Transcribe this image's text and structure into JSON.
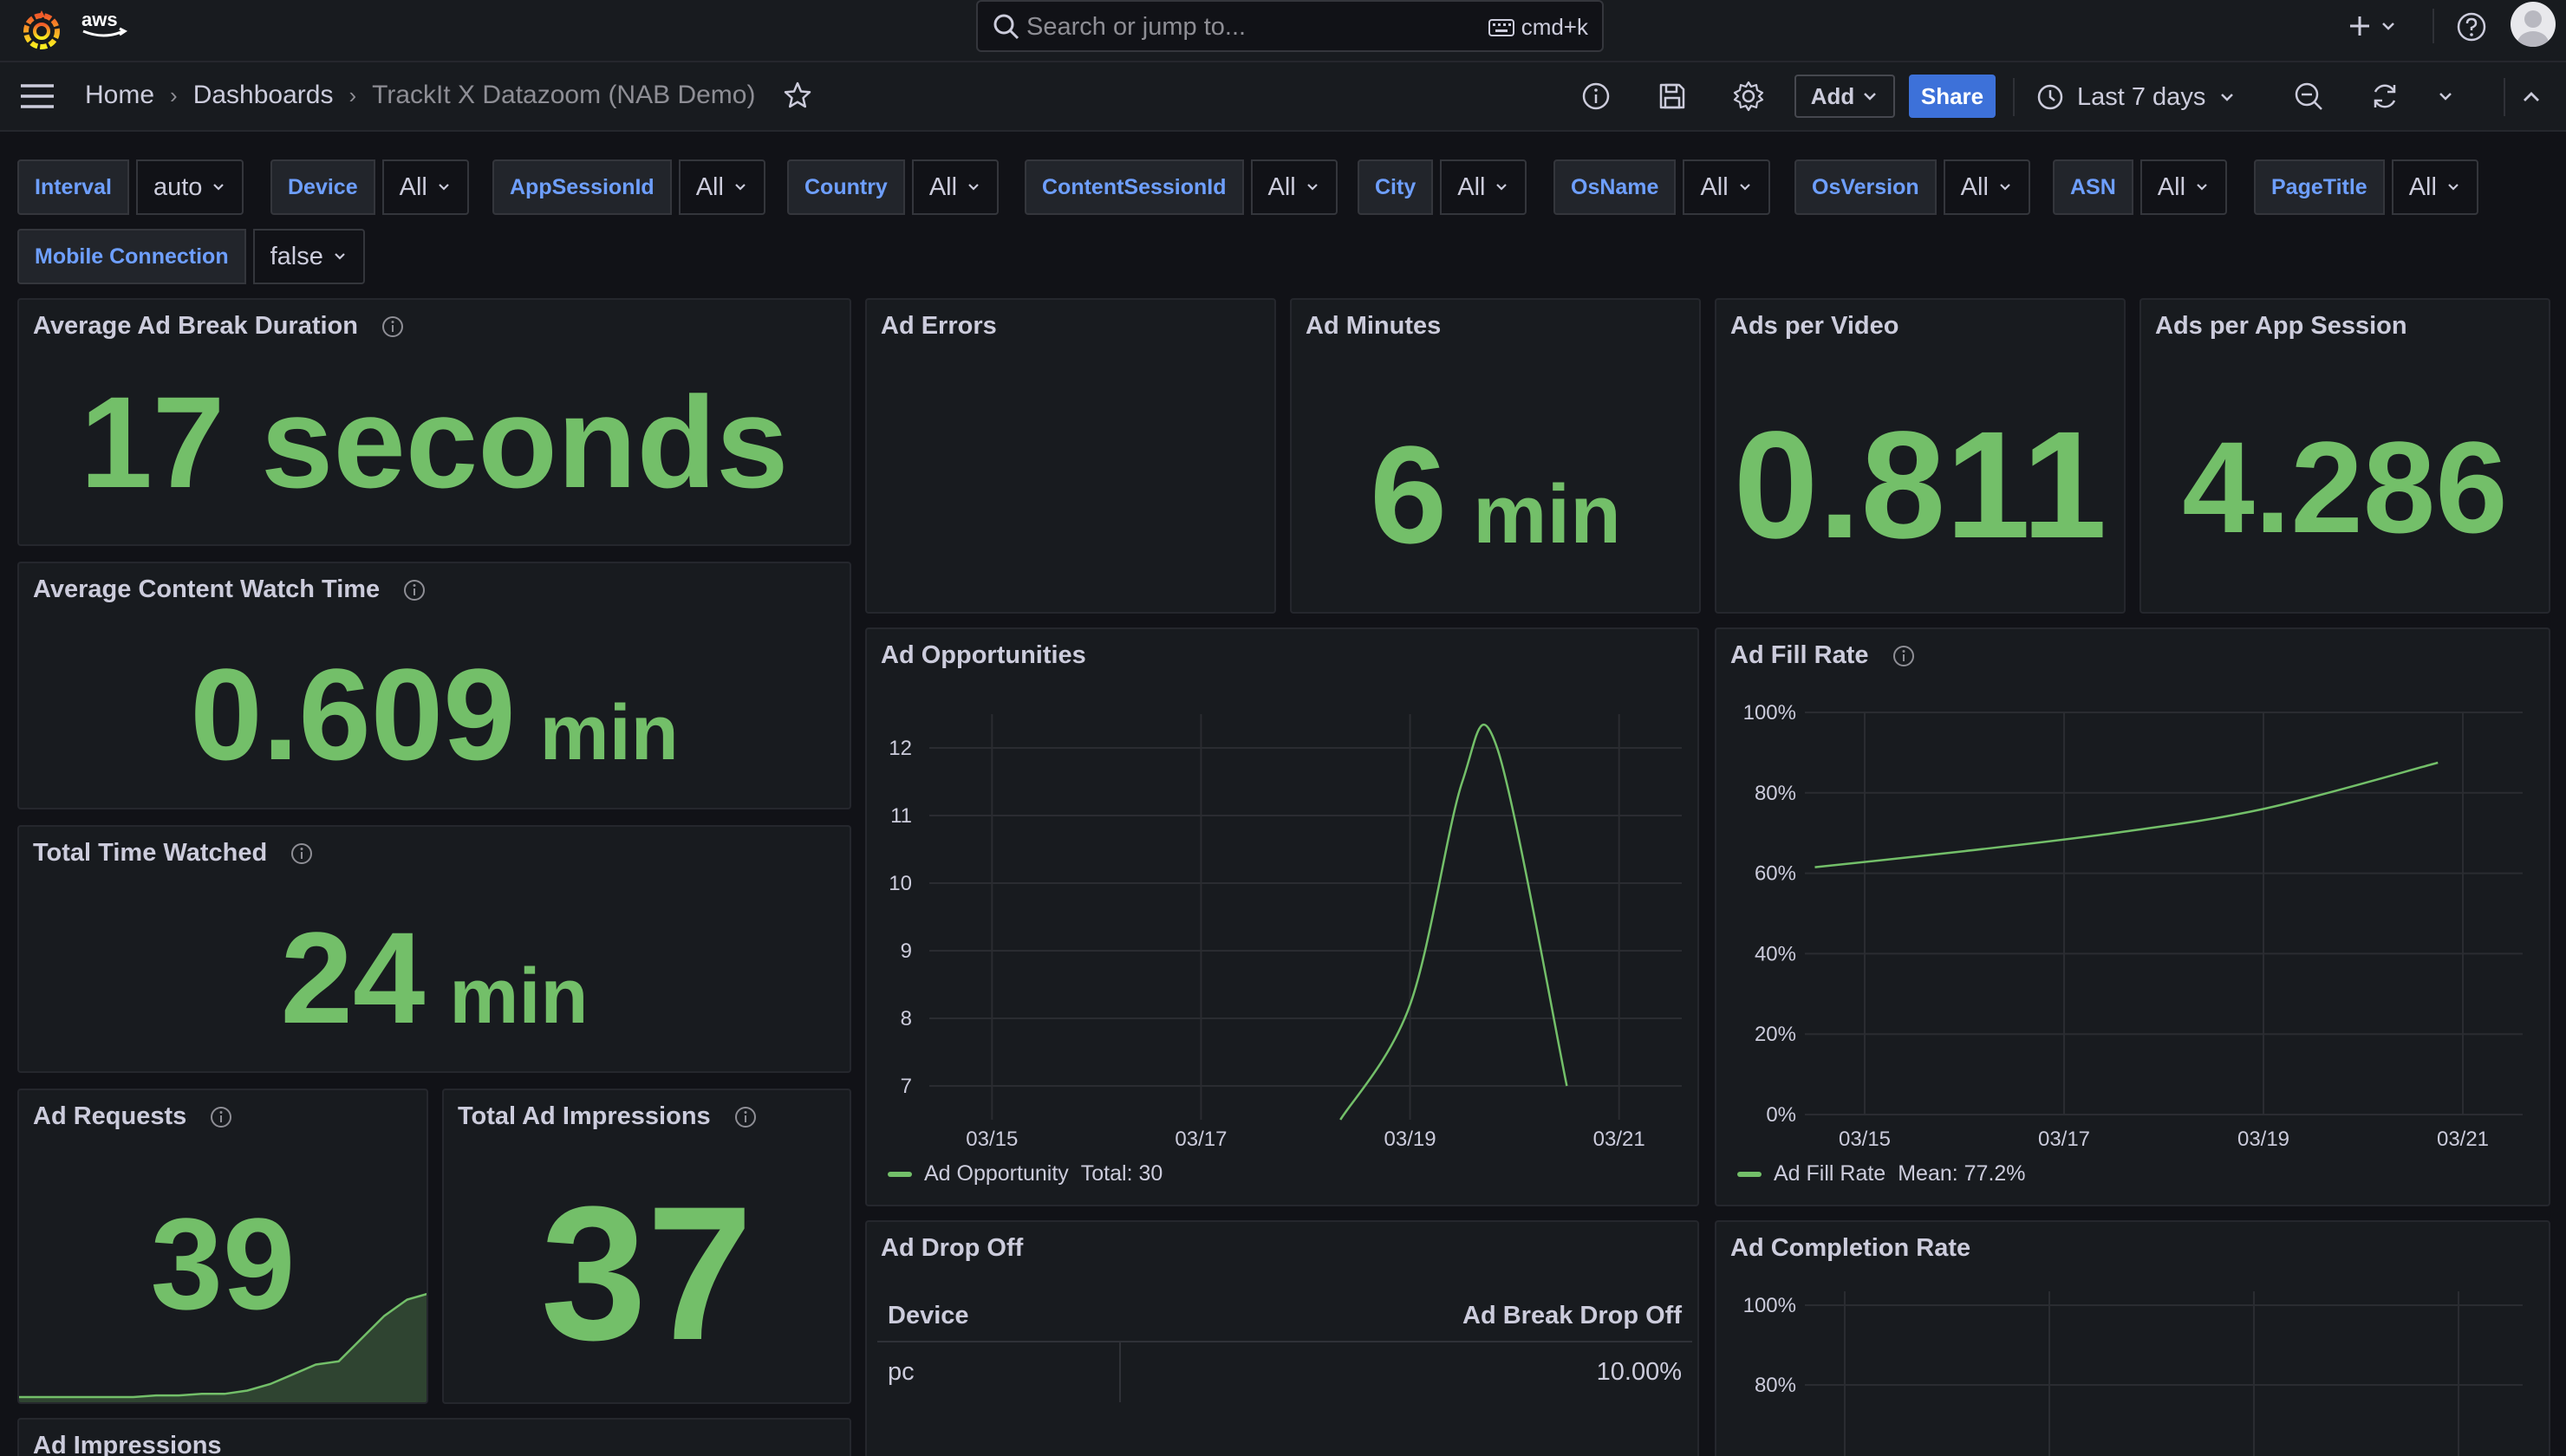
{
  "app": {
    "search_placeholder": "Search or jump to...",
    "search_shortcut": "cmd+k",
    "accent_color": "#73bf69",
    "primary_button_color": "#3d71d9"
  },
  "breadcrumb": {
    "home": "Home",
    "dashboards": "Dashboards",
    "current": "TrackIt X Datazoom (NAB Demo)"
  },
  "toolbar": {
    "add_label": "Add",
    "share_label": "Share",
    "time_range": "Last 7 days"
  },
  "variables": [
    {
      "label": "Interval",
      "value": "auto"
    },
    {
      "label": "Device",
      "value": "All"
    },
    {
      "label": "AppSessionId",
      "value": "All"
    },
    {
      "label": "Country",
      "value": "All"
    },
    {
      "label": "ContentSessionId",
      "value": "All"
    },
    {
      "label": "City",
      "value": "All"
    },
    {
      "label": "OsName",
      "value": "All"
    },
    {
      "label": "OsVersion",
      "value": "All"
    },
    {
      "label": "ASN",
      "value": "All"
    },
    {
      "label": "PageTitle",
      "value": "All"
    },
    {
      "label": "Mobile Connection",
      "value": "false"
    }
  ],
  "panels": {
    "avg_ad_break": {
      "title": "Average Ad Break Duration",
      "value": "17 seconds"
    },
    "avg_content_watch": {
      "title": "Average Content Watch Time",
      "value": "0.609",
      "unit": "min"
    },
    "total_time_watched": {
      "title": "Total Time Watched",
      "value": "24",
      "unit": "min"
    },
    "ad_requests": {
      "title": "Ad Requests",
      "value": "39"
    },
    "total_ad_impressions": {
      "title": "Total Ad Impressions",
      "value": "37"
    },
    "ad_impressions": {
      "title": "Ad Impressions"
    },
    "ad_errors": {
      "title": "Ad Errors"
    },
    "ad_minutes": {
      "title": "Ad Minutes",
      "value": "6",
      "unit": "min"
    },
    "ads_per_video": {
      "title": "Ads per Video",
      "value": "0.811"
    },
    "ads_per_app_session": {
      "title": "Ads per App Session",
      "value": "4.286"
    },
    "ad_opportunities": {
      "title": "Ad Opportunities",
      "legend_name": "Ad Opportunity",
      "legend_stat": "Total: 30"
    },
    "ad_fill_rate": {
      "title": "Ad Fill Rate",
      "legend_name": "Ad Fill Rate",
      "legend_stat": "Mean: 77.2%"
    },
    "ad_drop_off": {
      "title": "Ad Drop Off",
      "columns": [
        "Device",
        "Ad Break Drop Off"
      ],
      "rows": [
        [
          "pc",
          "10.00%"
        ]
      ]
    },
    "ad_completion_rate": {
      "title": "Ad Completion Rate"
    }
  },
  "chart_data": [
    {
      "type": "line",
      "id": "ad_opportunities",
      "x_ticks": [
        "03/15",
        "03/17",
        "03/19",
        "03/21"
      ],
      "y_ticks": [
        7,
        8,
        9,
        10,
        11,
        12
      ],
      "ylim": [
        6.5,
        12.5
      ],
      "series": [
        {
          "name": "Ad Opportunity",
          "points": [
            [
              "03/18 08:00",
              6.5
            ],
            [
              "03/19 00:00",
              8.2
            ],
            [
              "03/19 12:00",
              11.5
            ],
            [
              "03/19 20:00",
              12.0
            ],
            [
              "03/20 12:00",
              7.0
            ]
          ]
        }
      ]
    },
    {
      "type": "line",
      "id": "ad_fill_rate",
      "x_ticks": [
        "03/15",
        "03/17",
        "03/19",
        "03/21"
      ],
      "y_ticks": [
        "0%",
        "20%",
        "40%",
        "60%",
        "80%",
        "100%"
      ],
      "ylim": [
        0,
        100
      ],
      "series": [
        {
          "name": "Ad Fill Rate",
          "points": [
            [
              "03/14 12:00",
              61.5
            ],
            [
              "03/16 00:00",
              65.5
            ],
            [
              "03/17 12:00",
              70.0
            ],
            [
              "03/19 00:00",
              76.0
            ],
            [
              "03/20 18:00",
              87.5
            ]
          ]
        }
      ]
    },
    {
      "type": "area",
      "id": "ad_requests_sparkline",
      "values": [
        0,
        0,
        0,
        0,
        0,
        0,
        0.5,
        0.5,
        1,
        1,
        2,
        4,
        7,
        10,
        11,
        18,
        25,
        30,
        32
      ]
    },
    {
      "type": "line",
      "id": "ad_completion_rate",
      "y_ticks": [
        "80%",
        "100%"
      ]
    }
  ]
}
